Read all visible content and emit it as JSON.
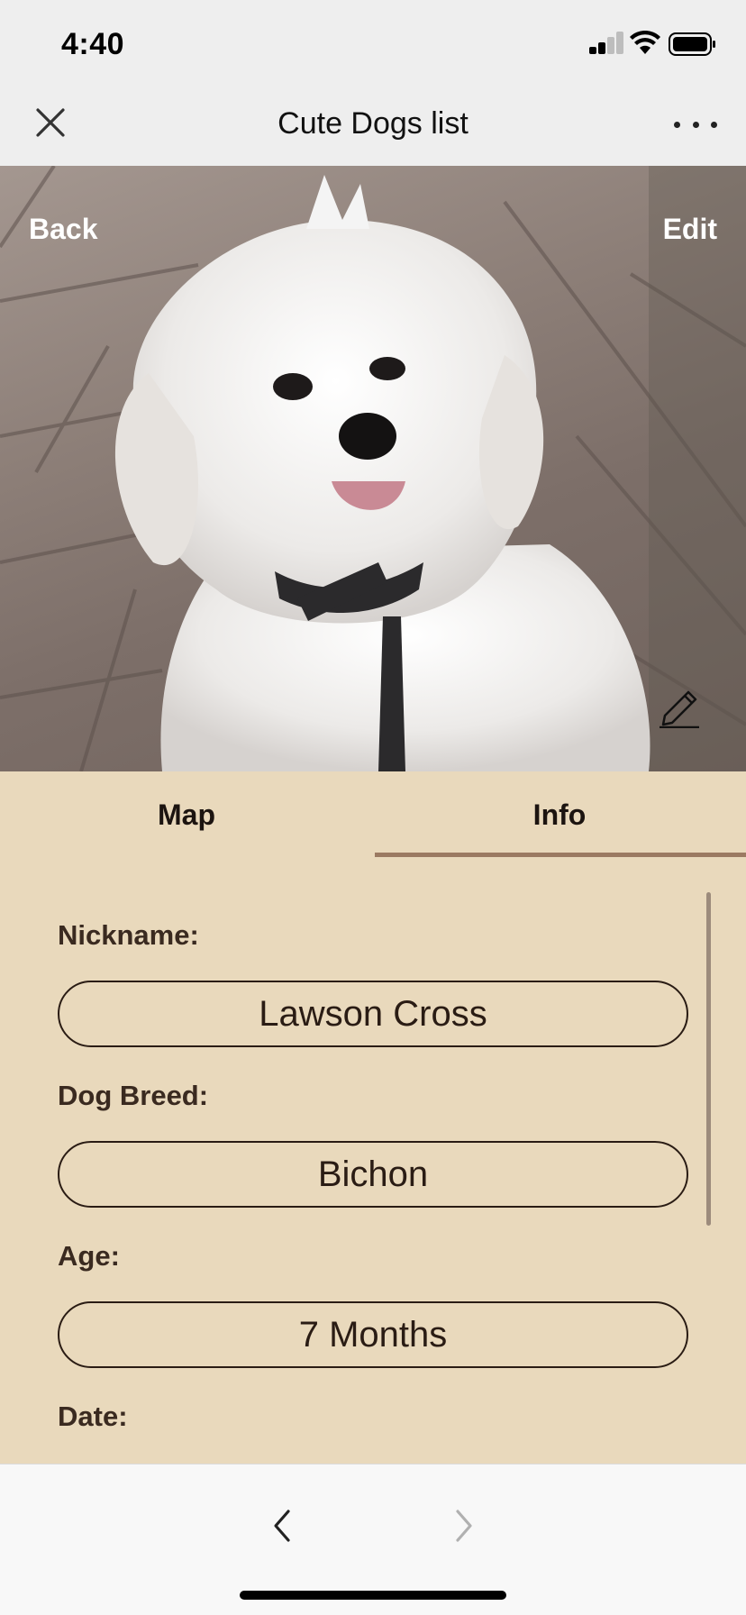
{
  "status_bar": {
    "time": "4:40",
    "signal_icon": "cellular-signal-icon",
    "wifi_icon": "wifi-icon",
    "battery_icon": "battery-icon"
  },
  "nav_bar": {
    "title": "Cute Dogs list",
    "close_icon": "close-icon",
    "more_icon": "more-dots-icon"
  },
  "hero": {
    "image": "white-fluffy-dog-photo",
    "back_label": "Back",
    "edit_label": "Edit",
    "edit_photo_icon": "pencil-icon"
  },
  "tabs": [
    {
      "label": "Map",
      "selected": false
    },
    {
      "label": "Info",
      "selected": true
    }
  ],
  "form": {
    "nickname_label": "Nickname:",
    "nickname_value": "Lawson Cross",
    "breed_label": "Dog Breed:",
    "breed_value": "Bichon",
    "age_label": "Age:",
    "age_value": "7 Months",
    "date_label": "Date:"
  },
  "toolbar": {
    "back_icon": "chevron-left-icon",
    "forward_icon": "chevron-right-icon",
    "forward_enabled": false
  },
  "colors": {
    "panel_bg": "#e9d9bc",
    "tab_indicator": "#9b7a62",
    "text_dark": "#2a1c14"
  }
}
